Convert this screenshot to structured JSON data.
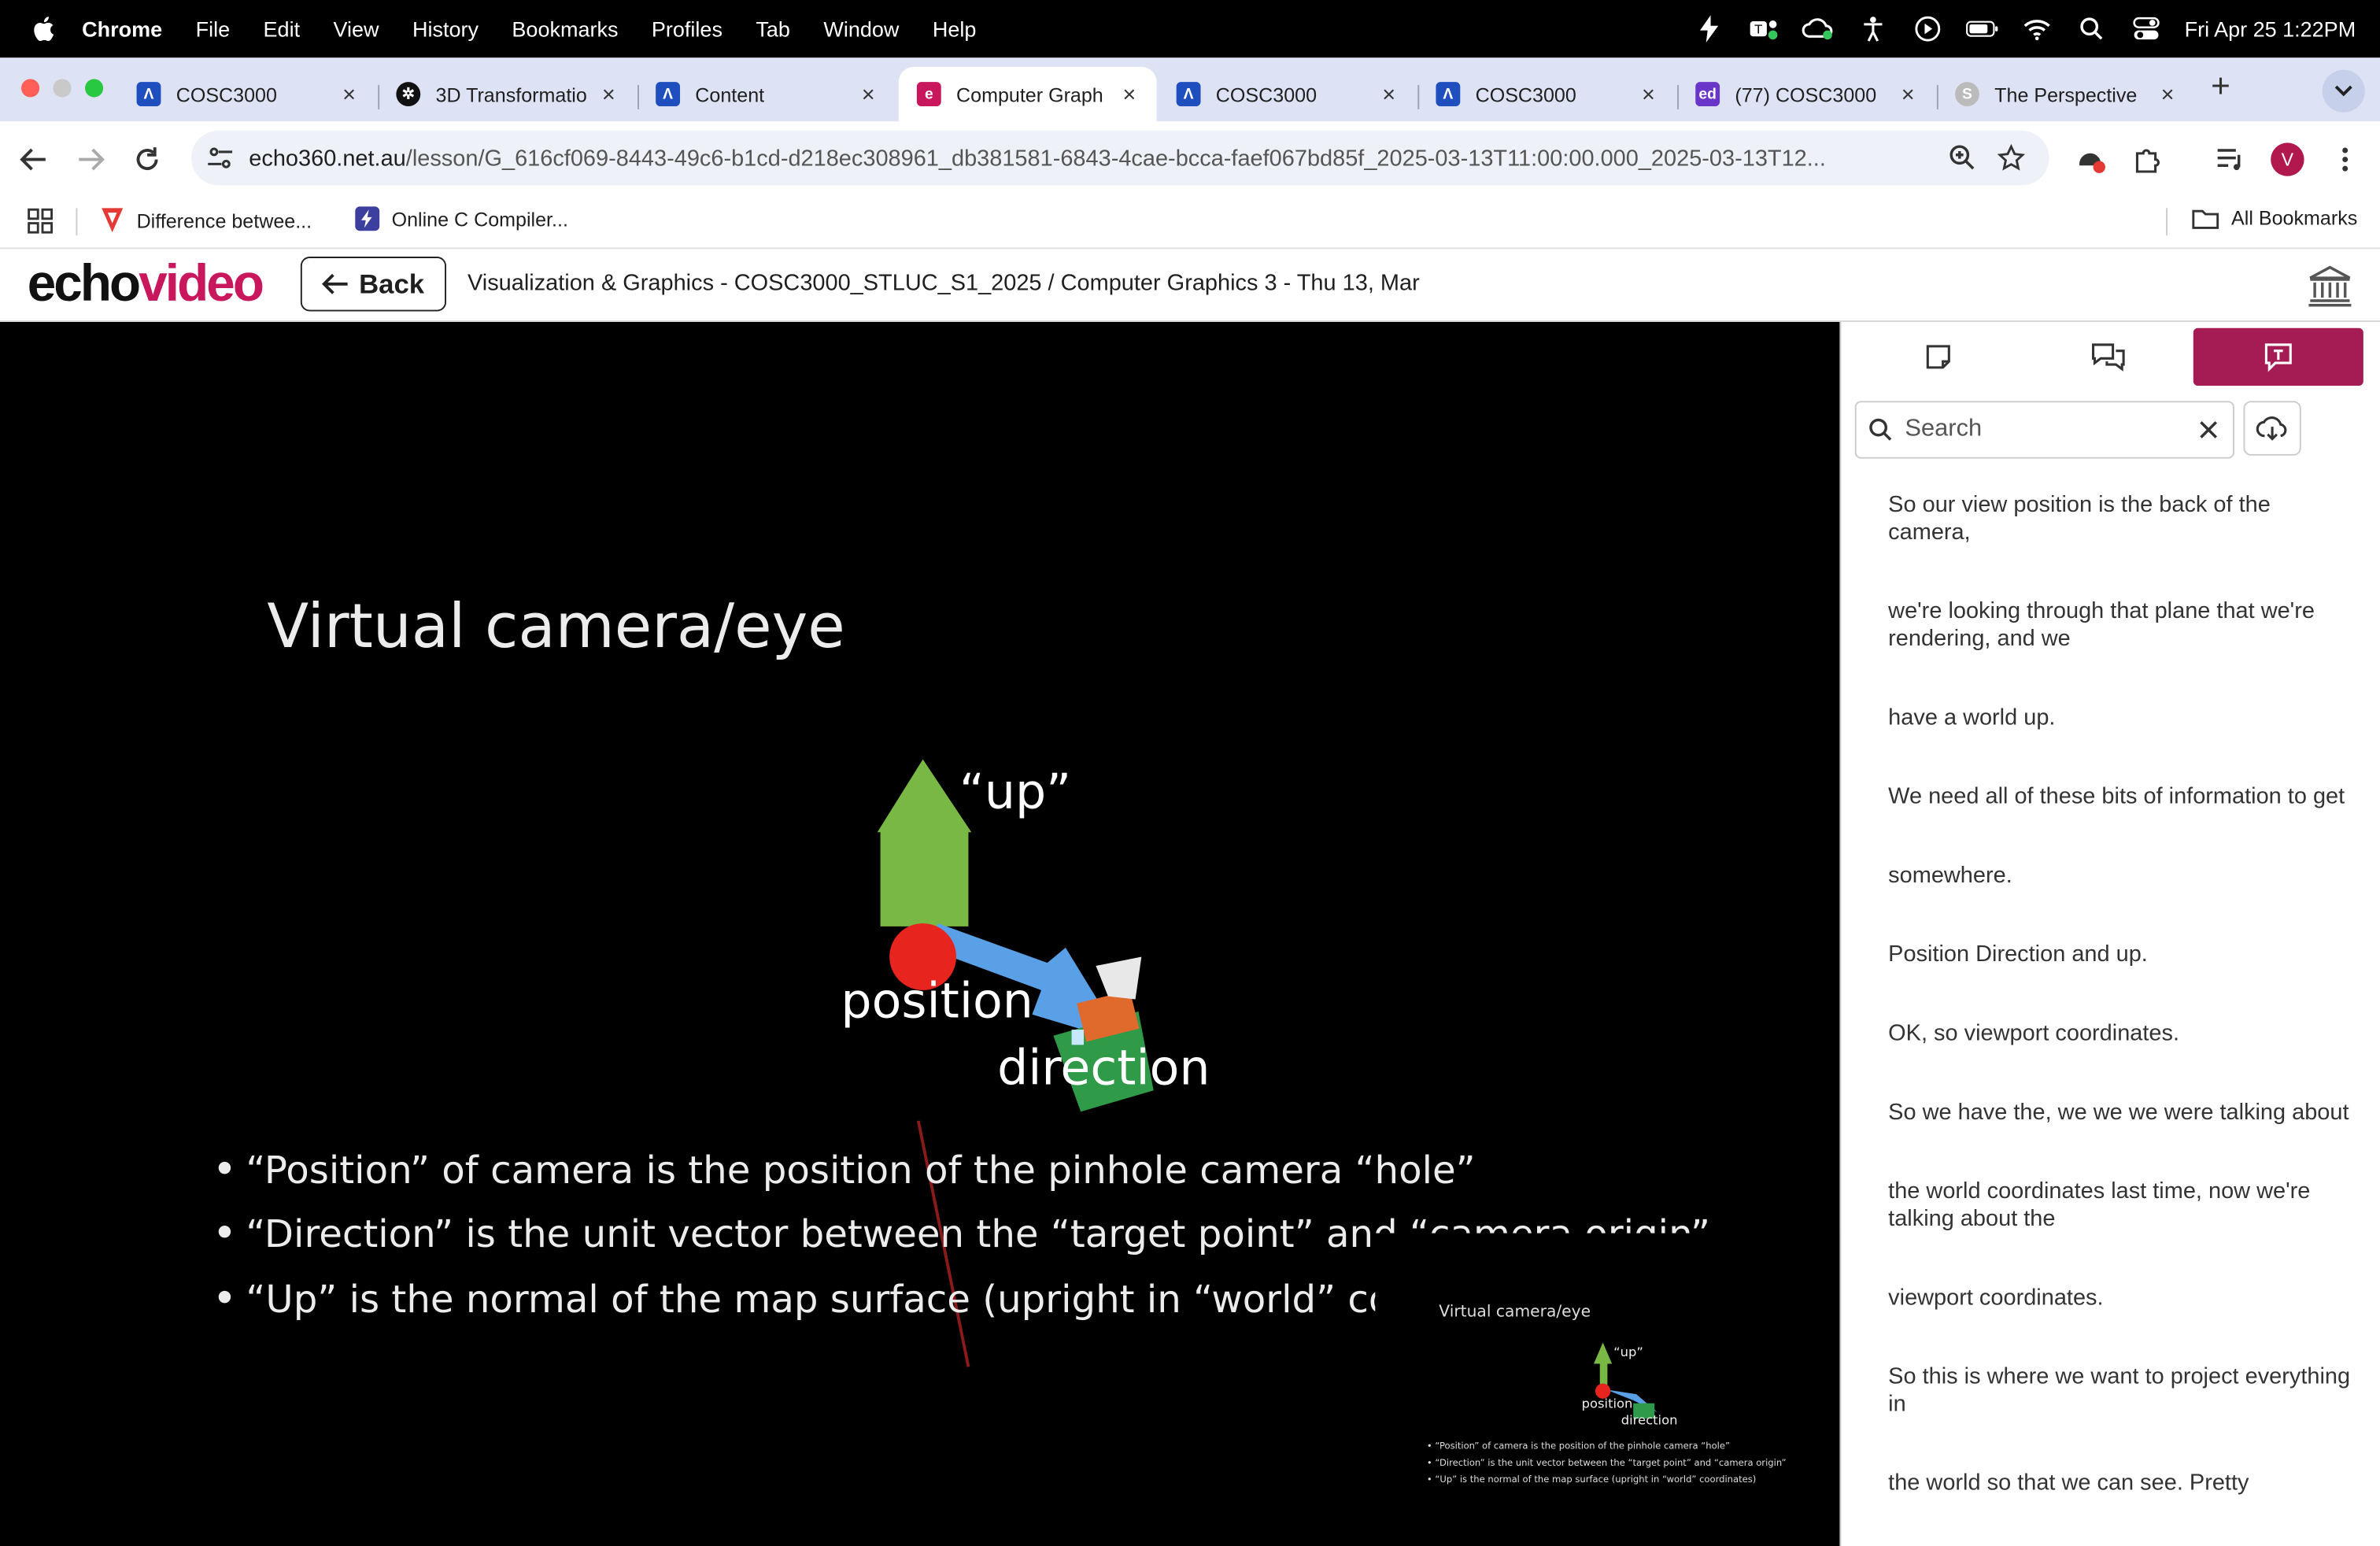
{
  "menubar": {
    "app": "Chrome",
    "items": [
      "File",
      "Edit",
      "View",
      "History",
      "Bookmarks",
      "Profiles",
      "Tab",
      "Window",
      "Help"
    ],
    "status_icons": [
      "bolt-icon",
      "teams-icon",
      "cloud-sync-icon",
      "accessibility-icon",
      "play-icon",
      "battery-icon",
      "wifi-icon",
      "spotlight-icon",
      "control-center-icon"
    ],
    "clock": "Fri Apr 25  1:22PM"
  },
  "tabs": [
    {
      "title": "COSC3000",
      "icon": "a-logo-icon",
      "color": "#1f4fbf",
      "active": false
    },
    {
      "title": "3D Transformatio",
      "icon": "chatgpt-icon",
      "color": "#111111",
      "active": false
    },
    {
      "title": "Content",
      "icon": "a-logo-icon",
      "color": "#1f4fbf",
      "active": false
    },
    {
      "title": "Computer Graph",
      "icon": "echo-icon",
      "color": "#c8175d",
      "active": true
    },
    {
      "title": "COSC3000",
      "icon": "a-logo-icon",
      "color": "#1f4fbf",
      "active": false
    },
    {
      "title": "COSC3000",
      "icon": "a-logo-icon",
      "color": "#1f4fbf",
      "active": false
    },
    {
      "title": "(77) COSC3000",
      "icon": "ed-icon",
      "color": "#6a36c9",
      "active": false
    },
    {
      "title": "The Perspective",
      "icon": "globe-icon",
      "color": "#bbbbbb",
      "active": false
    }
  ],
  "address": {
    "host": "echo360.net.au",
    "path": "/lesson/G_616cf069-8443-49c6-b1cd-d218ec308961_db381581-6843-4cae-bcca-faef067bd85f_2025-03-13T11:00:00.000_2025-03-13T12..."
  },
  "bookmarks": [
    {
      "label": "Difference betwee...",
      "icon": "triangle-logo-icon"
    },
    {
      "label": "Online C Compiler...",
      "icon": "bolt-logo-icon"
    }
  ],
  "all_bookmarks": "All Bookmarks",
  "echo": {
    "logo_a": "echo",
    "logo_b": "video",
    "back": "Back",
    "breadcrumb": "Visualization & Graphics - COSC3000_STLUC_S1_2025 / Computer Graphics 3 - Thu 13, Mar"
  },
  "slide": {
    "title": "Virtual camera/eye",
    "up_label": "“up”",
    "position_label": "position",
    "direction_label": "direction",
    "bullets": [
      "“Position” of camera is the position of the pinhole camera “hole”",
      "“Direction” is the unit vector between the “target point” and “camera origin”",
      "“Up” is the normal of the map surface (upright in “world” coor"
    ],
    "thumb_title": "Virtual camera/eye",
    "thumb_up": "“up”",
    "thumb_position": "position",
    "thumb_direction": "direction",
    "thumb_bullets": [
      "• “Position” of camera is the position of the pinhole camera “hole”",
      "• “Direction” is the unit vector between the “target point” and “camera origin”",
      "• “Up” is the normal of the map surface (upright in “world” coordinates)"
    ]
  },
  "sidebar": {
    "tabs": [
      "notes-icon",
      "discussion-icon",
      "transcript-icon"
    ],
    "search_placeholder": "Search",
    "transcript": [
      "So our view position is the back of the camera,",
      "we're looking through that plane that we're rendering, and we",
      "have a world up.",
      "We need all of these bits of information to get",
      "somewhere.",
      "Position Direction and up.",
      "OK, so viewport coordinates.",
      "So we have the, we we we were talking about",
      "the world coordinates last time, now we're talking about the",
      "viewport coordinates.",
      "So this is where we want to project everything in",
      "the world so that we can see. Pretty"
    ]
  },
  "colors": {
    "accent": "#a51c55",
    "brand": "#c8175d",
    "tabbar": "#dde3f4"
  }
}
